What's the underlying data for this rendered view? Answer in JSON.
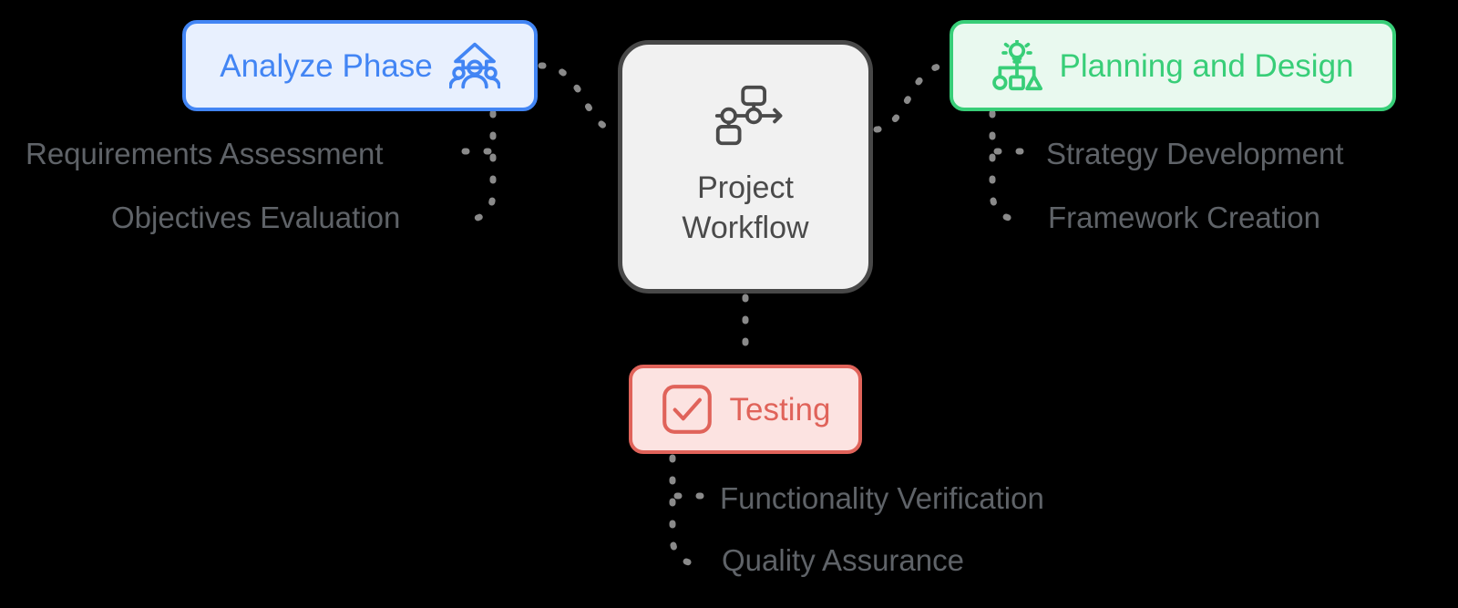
{
  "diagram": {
    "title": "Project Workflow",
    "center": {
      "line1": "Project",
      "line2": "Workflow",
      "text": "Project\nWorkflow",
      "icon": "workflow-icon",
      "fill": "#F1F1F1",
      "border": "#484848",
      "text_color": "#4A4A4A"
    },
    "background": "#000000",
    "connector_color": "#8A8A8A",
    "connector_style": "dashed"
  },
  "branches": [
    {
      "id": "analyze",
      "label": "Analyze Phase",
      "icon": "team-growth-icon",
      "color": "#4285F4",
      "fill": "#E8F0FE",
      "position": "top-left",
      "items": [
        {
          "label": "Requirements Assessment"
        },
        {
          "label": "Objectives Evaluation"
        }
      ]
    },
    {
      "id": "planning",
      "label": "Planning and Design",
      "icon": "lightbulb-hierarchy-icon",
      "color": "#38CE78",
      "fill": "#E9F9EF",
      "position": "top-right",
      "items": [
        {
          "label": "Strategy Development"
        },
        {
          "label": "Framework Creation"
        }
      ]
    },
    {
      "id": "testing",
      "label": "Testing",
      "icon": "check-square-icon",
      "color": "#E0635A",
      "fill": "#FCE3E1",
      "position": "bottom",
      "items": [
        {
          "label": "Functionality Verification"
        },
        {
          "label": "Quality Assurance"
        }
      ]
    }
  ],
  "sub_labels": {
    "requirements_assessment": "Requirements Assessment",
    "objectives_evaluation": "Objectives Evaluation",
    "strategy_development": "Strategy Development",
    "framework_creation": "Framework Creation",
    "functionality_verification": "Functionality Verification",
    "quality_assurance": "Quality Assurance"
  }
}
